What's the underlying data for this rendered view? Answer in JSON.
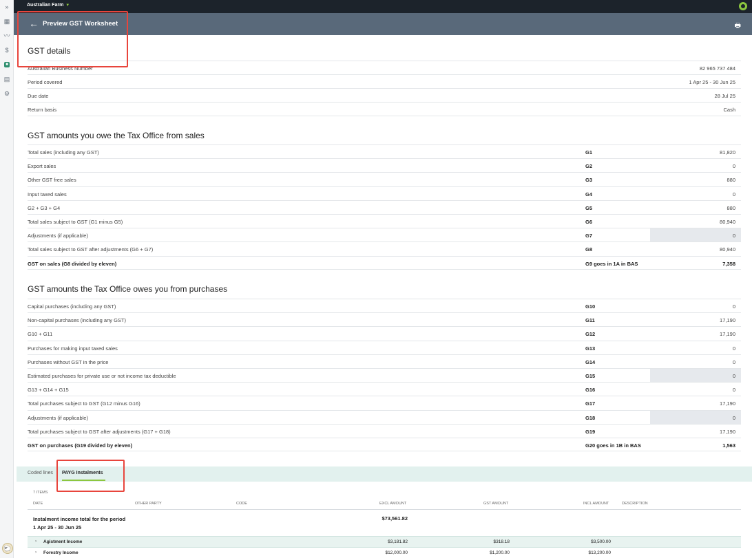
{
  "sidebar": {
    "expand_icon": "»",
    "items": [
      {
        "icon": "dashboard-icon",
        "glyph": "▦"
      },
      {
        "icon": "chart-icon",
        "glyph": "〰"
      },
      {
        "icon": "dollar-icon",
        "glyph": "$"
      },
      {
        "icon": "ledger-icon",
        "glyph": "■"
      },
      {
        "icon": "inventory-icon",
        "glyph": "▤"
      },
      {
        "icon": "settings-icon",
        "glyph": "⚙"
      }
    ]
  },
  "topbar": {
    "org_name": "Australian Farm",
    "caret": "▼"
  },
  "header": {
    "back_glyph": "←",
    "title": "Preview GST Worksheet",
    "print_glyph": "🖶"
  },
  "gst_details": {
    "title": "GST details",
    "rows": [
      {
        "label": "Australian Business Number",
        "value": "82 965 737 484"
      },
      {
        "label": "Period covered",
        "value": "1 Apr 25 - 30 Jun 25"
      },
      {
        "label": "Due date",
        "value": "28 Jul 25"
      },
      {
        "label": "Return basis",
        "value": "Cash"
      }
    ]
  },
  "sales": {
    "title": "GST amounts you owe the Tax Office from sales",
    "rows": [
      {
        "label": "Total sales (including any GST)",
        "code": "G1",
        "value": "81,820"
      },
      {
        "label": "Export sales",
        "code": "G2",
        "value": "0"
      },
      {
        "label": "Other GST free sales",
        "code": "G3",
        "value": "880"
      },
      {
        "label": "Input taxed sales",
        "code": "G4",
        "value": "0"
      },
      {
        "label": "G2 + G3 + G4",
        "code": "G5",
        "value": "880"
      },
      {
        "label": "Total sales subject to GST (G1 minus G5)",
        "code": "G6",
        "value": "80,940"
      },
      {
        "label": "Adjustments (if applicable)",
        "code": "G7",
        "value": "0"
      },
      {
        "label": "Total sales subject to GST after adjustments (G6 + G7)",
        "code": "G8",
        "value": "80,940"
      },
      {
        "label": "GST on sales (G8 divided by eleven)",
        "code": "G9 goes in 1A in BAS",
        "value": "7,358"
      }
    ]
  },
  "purchases": {
    "title": "GST amounts the Tax Office owes you from purchases",
    "rows": [
      {
        "label": "Capital purchases (including any GST)",
        "code": "G10",
        "value": "0"
      },
      {
        "label": "Non-capital purchases (including any GST)",
        "code": "G11",
        "value": "17,190"
      },
      {
        "label": "G10 + G11",
        "code": "G12",
        "value": "17,190"
      },
      {
        "label": "Purchases for making input taxed sales",
        "code": "G13",
        "value": "0"
      },
      {
        "label": "Purchases without GST in the price",
        "code": "G14",
        "value": "0"
      },
      {
        "label": "Estimated purchases for private use or not income tax deductible",
        "code": "G15",
        "value": "0"
      },
      {
        "label": "G13 + G14 + G15",
        "code": "G16",
        "value": "0"
      },
      {
        "label": "Total purchases subject to GST (G12 minus G16)",
        "code": "G17",
        "value": "17,190"
      },
      {
        "label": "Adjustments (if applicable)",
        "code": "G18",
        "value": "0"
      },
      {
        "label": "Total purchases subject to GST after adjustments (G17 + G18)",
        "code": "G19",
        "value": "17,190"
      },
      {
        "label": "GST on purchases (G19 divided by eleven)",
        "code": "G20 goes in 1B in BAS",
        "value": "1,563"
      }
    ]
  },
  "tabs": [
    {
      "label": "Coded lines"
    },
    {
      "label": "PAYG Instalments"
    }
  ],
  "table": {
    "items_count": "7 ITEMS",
    "headers": [
      "DATE",
      "OTHER PARTY",
      "CODE",
      "EXCL AMOUNT",
      "GST AMOUNT",
      "INCL AMOUNT",
      "DESCRIPTION"
    ],
    "summary_label_line1": "Instalment income total for the period",
    "summary_label_line2": "1 Apr 25 - 30 Jun 25",
    "summary_value": "$73,561.82",
    "rows": [
      {
        "name": "Agistment Income",
        "excl": "$3,181.82",
        "gst": "$318.18",
        "incl": "$3,500.00"
      },
      {
        "name": "Forestry Income",
        "excl": "$12,000.00",
        "gst": "$1,200.00",
        "incl": "$13,200.00"
      }
    ],
    "chevron": "›"
  }
}
